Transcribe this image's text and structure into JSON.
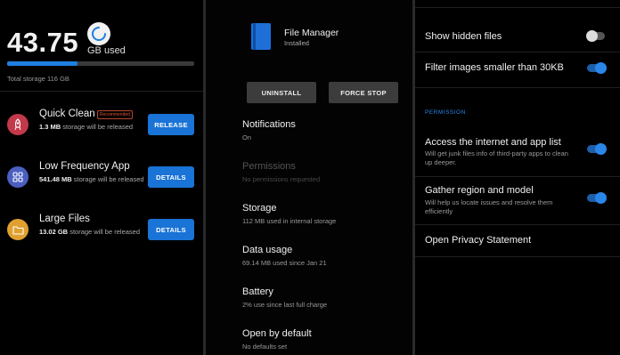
{
  "storage_screen": {
    "used_value": "43.75",
    "used_unit": "GB used",
    "used_fraction": 0.377,
    "total_storage": "Total storage 116 GB",
    "items": [
      {
        "title": "Quick Clean",
        "badge": "Recommended",
        "size": "1.3 MB",
        "desc": "storage will be released",
        "button": "RELEASE",
        "icon": "rocket-icon",
        "icon_color": "#c2394a"
      },
      {
        "title": "Low Frequency App",
        "size": "541.48 MB",
        "desc": "storage will be released",
        "button": "DETAILS",
        "icon": "apps-grid-icon",
        "icon_color": "#4b5fc0"
      },
      {
        "title": "Large Files",
        "size": "13.02 GB",
        "desc": "storage will be released",
        "button": "DETAILS",
        "icon": "folder-icon",
        "icon_color": "#e0a030"
      }
    ]
  },
  "app_info_screen": {
    "app_name": "File Manager",
    "app_status": "Installed",
    "uninstall_label": "UNINSTALL",
    "force_stop_label": "FORCE STOP",
    "settings": [
      {
        "title": "Notifications",
        "subtitle": "On",
        "enabled": true
      },
      {
        "title": "Permissions",
        "subtitle": "No permissions requested",
        "enabled": false
      },
      {
        "title": "Storage",
        "subtitle": "112 MB used in internal storage",
        "enabled": true
      },
      {
        "title": "Data usage",
        "subtitle": "69.14 MB used since Jan 21",
        "enabled": true
      },
      {
        "title": "Battery",
        "subtitle": "2% use since last full charge",
        "enabled": true
      },
      {
        "title": "Open by default",
        "subtitle": "No defaults set",
        "enabled": true
      }
    ]
  },
  "settings_screen": {
    "show_hidden_files": {
      "label": "Show hidden files",
      "on": false
    },
    "filter_images": {
      "label": "Filter images smaller than 30KB",
      "on": true
    },
    "section_label": "PERMISSION",
    "internet_access": {
      "label": "Access the internet and app list",
      "desc": "Will get junk files info of third-party apps to clean up deeper.",
      "on": true
    },
    "region_model": {
      "label": "Gather region and model",
      "desc": "Will help us locate issues and resolve them efficiently",
      "on": true
    },
    "privacy_statement": {
      "label": "Open Privacy Statement"
    }
  },
  "colors": {
    "accent": "#1a73d6",
    "toggle_on": "#2a86e8",
    "badge": "#e0503a"
  }
}
